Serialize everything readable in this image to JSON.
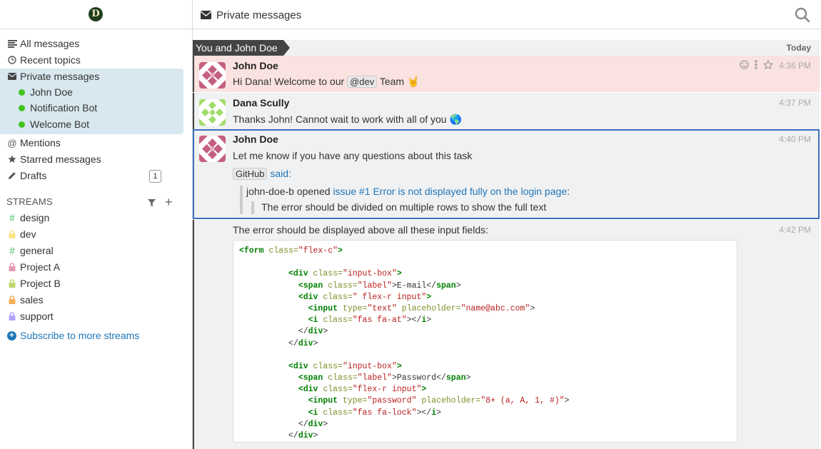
{
  "header": {
    "logo_letter": "D",
    "title": "Private messages"
  },
  "sidebar": {
    "items": [
      {
        "label": "All messages",
        "icon": "all-messages-icon"
      },
      {
        "label": "Recent topics",
        "icon": "clock-icon"
      },
      {
        "label": "Private messages",
        "icon": "envelope-icon"
      },
      {
        "label": "Mentions",
        "icon": "at-icon"
      },
      {
        "label": "Starred messages",
        "icon": "star-icon"
      },
      {
        "label": "Drafts",
        "icon": "pencil-icon",
        "count": "1"
      }
    ],
    "pm_users": [
      {
        "name": "John Doe",
        "status_color": "#44c21d"
      },
      {
        "name": "Notification Bot",
        "status_color": "#44c21d"
      },
      {
        "name": "Welcome Bot",
        "status_color": "#44c21d"
      }
    ],
    "streams_label": "STREAMS",
    "streams": [
      {
        "name": "design",
        "icon": "hash",
        "color": "#76ce90"
      },
      {
        "name": "dev",
        "icon": "lock",
        "color": "#fae589"
      },
      {
        "name": "general",
        "icon": "hash",
        "color": "#76ce90"
      },
      {
        "name": "Project A",
        "icon": "lock",
        "color": "#e79ab5"
      },
      {
        "name": "Project B",
        "icon": "lock",
        "color": "#bfd56f"
      },
      {
        "name": "sales",
        "icon": "lock",
        "color": "#f4ae55"
      },
      {
        "name": "support",
        "icon": "lock",
        "color": "#b0a5fd"
      }
    ],
    "subscribe_label": "Subscribe to more streams"
  },
  "conversation": {
    "recipient": "You and John Doe",
    "date": "Today",
    "messages": [
      {
        "sender": "John Doe",
        "time": "4:36 PM",
        "text_before": "Hi Dana! Welcome to our ",
        "mention": "@dev",
        "text_after": " Team 🤘"
      },
      {
        "sender": "Dana Scully",
        "time": "4:37 PM",
        "text": "Thanks John! Cannot wait to work with all of you 🌎"
      },
      {
        "sender": "John Doe",
        "time": "4:40 PM",
        "text": "Let me know if you have any questions about this task",
        "bot_name": "GitHub",
        "said": "said:",
        "event_prefix": "john-doe-b opened ",
        "event_link": "issue #1 Error is not displayed fully on the login page",
        "event_suffix": ":",
        "quote": "The error should be divided on multiple rows to show the full text"
      },
      {
        "time": "4:42 PM",
        "text": "The error should be displayed above all these input fields:"
      }
    ]
  },
  "code_lines": [
    [
      [
        "tag",
        "<form"
      ],
      [
        "attr",
        " class="
      ],
      [
        "str",
        "\"flex-c\""
      ],
      [
        "tag",
        ">"
      ]
    ],
    [],
    [
      [
        "pun",
        "          "
      ],
      [
        "tag",
        "<div"
      ],
      [
        "attr",
        " class="
      ],
      [
        "str",
        "\"input-box\""
      ],
      [
        "tag",
        ">"
      ]
    ],
    [
      [
        "pun",
        "            "
      ],
      [
        "tag",
        "<span"
      ],
      [
        "attr",
        " class="
      ],
      [
        "str",
        "\"label\""
      ],
      [
        "pun",
        ">E-mail</"
      ],
      [
        "tag",
        "span"
      ],
      [
        "pun",
        ">"
      ]
    ],
    [
      [
        "pun",
        "            "
      ],
      [
        "tag",
        "<div"
      ],
      [
        "attr",
        " class="
      ],
      [
        "str",
        "\" flex-r input\""
      ],
      [
        "tag",
        ">"
      ]
    ],
    [
      [
        "pun",
        "              "
      ],
      [
        "tag",
        "<input"
      ],
      [
        "attr",
        " type="
      ],
      [
        "str",
        "\"text\""
      ],
      [
        "attr",
        " placeholder="
      ],
      [
        "str",
        "\"name@abc.com\""
      ],
      [
        "pun",
        ">"
      ]
    ],
    [
      [
        "pun",
        "              "
      ],
      [
        "tag",
        "<i"
      ],
      [
        "attr",
        " class="
      ],
      [
        "str",
        "\"fas fa-at\""
      ],
      [
        "pun",
        "></"
      ],
      [
        "tag",
        "i"
      ],
      [
        "pun",
        ">"
      ]
    ],
    [
      [
        "pun",
        "            "
      ],
      [
        "pun",
        "</"
      ],
      [
        "tag",
        "div"
      ],
      [
        "pun",
        ">"
      ]
    ],
    [
      [
        "pun",
        "          "
      ],
      [
        "pun",
        "</"
      ],
      [
        "tag",
        "div"
      ],
      [
        "pun",
        ">"
      ]
    ],
    [],
    [
      [
        "pun",
        "          "
      ],
      [
        "tag",
        "<div"
      ],
      [
        "attr",
        " class="
      ],
      [
        "str",
        "\"input-box\""
      ],
      [
        "tag",
        ">"
      ]
    ],
    [
      [
        "pun",
        "            "
      ],
      [
        "tag",
        "<span"
      ],
      [
        "attr",
        " class="
      ],
      [
        "str",
        "\"label\""
      ],
      [
        "pun",
        ">Password</"
      ],
      [
        "tag",
        "span"
      ],
      [
        "pun",
        ">"
      ]
    ],
    [
      [
        "pun",
        "            "
      ],
      [
        "tag",
        "<div"
      ],
      [
        "attr",
        " class="
      ],
      [
        "str",
        "\"flex-r input\""
      ],
      [
        "tag",
        ">"
      ]
    ],
    [
      [
        "pun",
        "              "
      ],
      [
        "tag",
        "<input"
      ],
      [
        "attr",
        " type="
      ],
      [
        "str",
        "\"password\""
      ],
      [
        "attr",
        " placeholder="
      ],
      [
        "str",
        "\"8+ (a, A, 1, #)\""
      ],
      [
        "pun",
        ">"
      ]
    ],
    [
      [
        "pun",
        "              "
      ],
      [
        "tag",
        "<i"
      ],
      [
        "attr",
        " class="
      ],
      [
        "str",
        "\"fas fa-lock\""
      ],
      [
        "pun",
        "></"
      ],
      [
        "tag",
        "i"
      ],
      [
        "pun",
        ">"
      ]
    ],
    [
      [
        "pun",
        "            "
      ],
      [
        "pun",
        "</"
      ],
      [
        "tag",
        "div"
      ],
      [
        "pun",
        ">"
      ]
    ],
    [
      [
        "pun",
        "          "
      ],
      [
        "pun",
        "</"
      ],
      [
        "tag",
        "div"
      ],
      [
        "pun",
        ">"
      ]
    ]
  ]
}
